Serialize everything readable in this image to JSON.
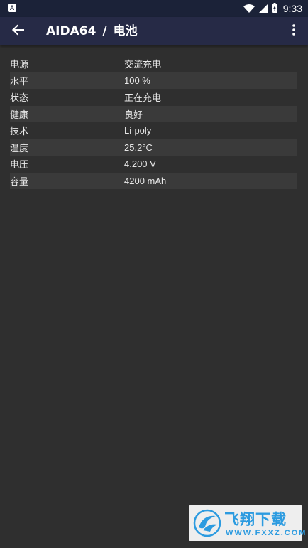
{
  "status_bar": {
    "notification_icon": "A",
    "time": "9:33"
  },
  "app_bar": {
    "app_name": "AIDA64",
    "separator": "/",
    "page_title": "电池"
  },
  "rows": [
    {
      "label": "电源",
      "value": "交流充电"
    },
    {
      "label": "水平",
      "value": "100 %"
    },
    {
      "label": "状态",
      "value": "正在充电"
    },
    {
      "label": "健康",
      "value": "良好"
    },
    {
      "label": "技术",
      "value": "Li-poly"
    },
    {
      "label": "温度",
      "value": "25.2°C"
    },
    {
      "label": "电压",
      "value": "4.200 V"
    },
    {
      "label": "容量",
      "value": "4200 mAh"
    }
  ],
  "watermark": {
    "brand_cn": "飞翔下载",
    "brand_en": "WWW.FXXZ.COM"
  },
  "colors": {
    "background": "#2f2f2f",
    "status_bar": "#1b2238",
    "app_bar": "#262a46",
    "row_alt": "#3a3a3a",
    "text": "#e8e8e8",
    "watermark_accent": "#2c9be0"
  }
}
